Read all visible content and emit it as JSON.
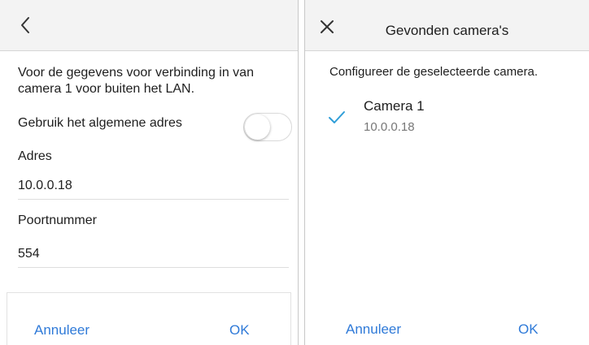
{
  "left_panel": {
    "description": "Voor de gegevens voor verbinding in van camera 1 voor buiten het LAN.",
    "toggle_label": "Gebruik het algemene adres",
    "toggle_on": false,
    "address_label": "Adres",
    "address_value": "10.0.0.18",
    "port_label": "Poortnummer",
    "port_value": "554",
    "cancel_label": "Annuleer",
    "ok_label": "OK"
  },
  "right_panel": {
    "title": "Gevonden camera's",
    "instruction": "Configureer de geselecteerde camera.",
    "cameras": [
      {
        "name": "Camera 1",
        "ip": "10.0.0.18",
        "selected": true
      }
    ],
    "cancel_label": "Annuleer",
    "ok_label": "OK"
  },
  "colors": {
    "accent": "#2f7ad8",
    "check": "#2f9ed8",
    "header_bg": "#f3f3f3",
    "secondary_text": "#777777"
  },
  "icons": [
    "back-chevron-icon",
    "close-icon",
    "checkmark-icon"
  ]
}
